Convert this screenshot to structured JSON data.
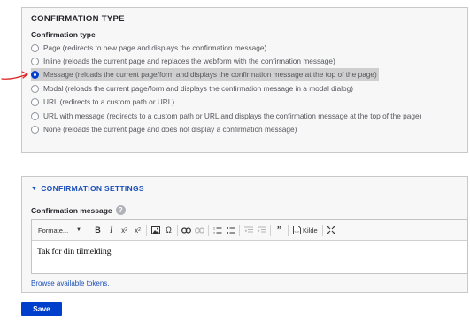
{
  "confirmation_type": {
    "title": "CONFIRMATION TYPE",
    "subtitle": "Confirmation type",
    "options": [
      {
        "label": "Page (redirects to new page and displays the confirmation message)",
        "selected": false
      },
      {
        "label": "Inline (reloads the current page and replaces the webform with the confirmation message)",
        "selected": false
      },
      {
        "label": "Message (reloads the current page/form and displays the confirmation message at the top of the page)",
        "selected": true
      },
      {
        "label": "Modal (reloads the current page/form and displays the confirmation message in a modal dialog)",
        "selected": false
      },
      {
        "label": "URL (redirects to a custom path or URL)",
        "selected": false
      },
      {
        "label": "URL with message (redirects to a custom path or URL and displays the confirmation message at the top of the page)",
        "selected": false
      },
      {
        "label": "None (reloads the current page and does not display a confirmation message)",
        "selected": false
      }
    ]
  },
  "annotation": {
    "arrow_color": "#e02020"
  },
  "confirmation_settings": {
    "summary": "CONFIRMATION SETTINGS",
    "message_label": "Confirmation message",
    "help_icon": "?",
    "toolbar": {
      "format_label": "Formate...",
      "source_label": "Kilde"
    },
    "editor_text": "Tak for din tilmelding",
    "tokens_link": "Browse available tokens."
  },
  "actions": {
    "save_label": "Save"
  },
  "colors": {
    "accent": "#003ecc",
    "link": "#1b4fb8"
  }
}
